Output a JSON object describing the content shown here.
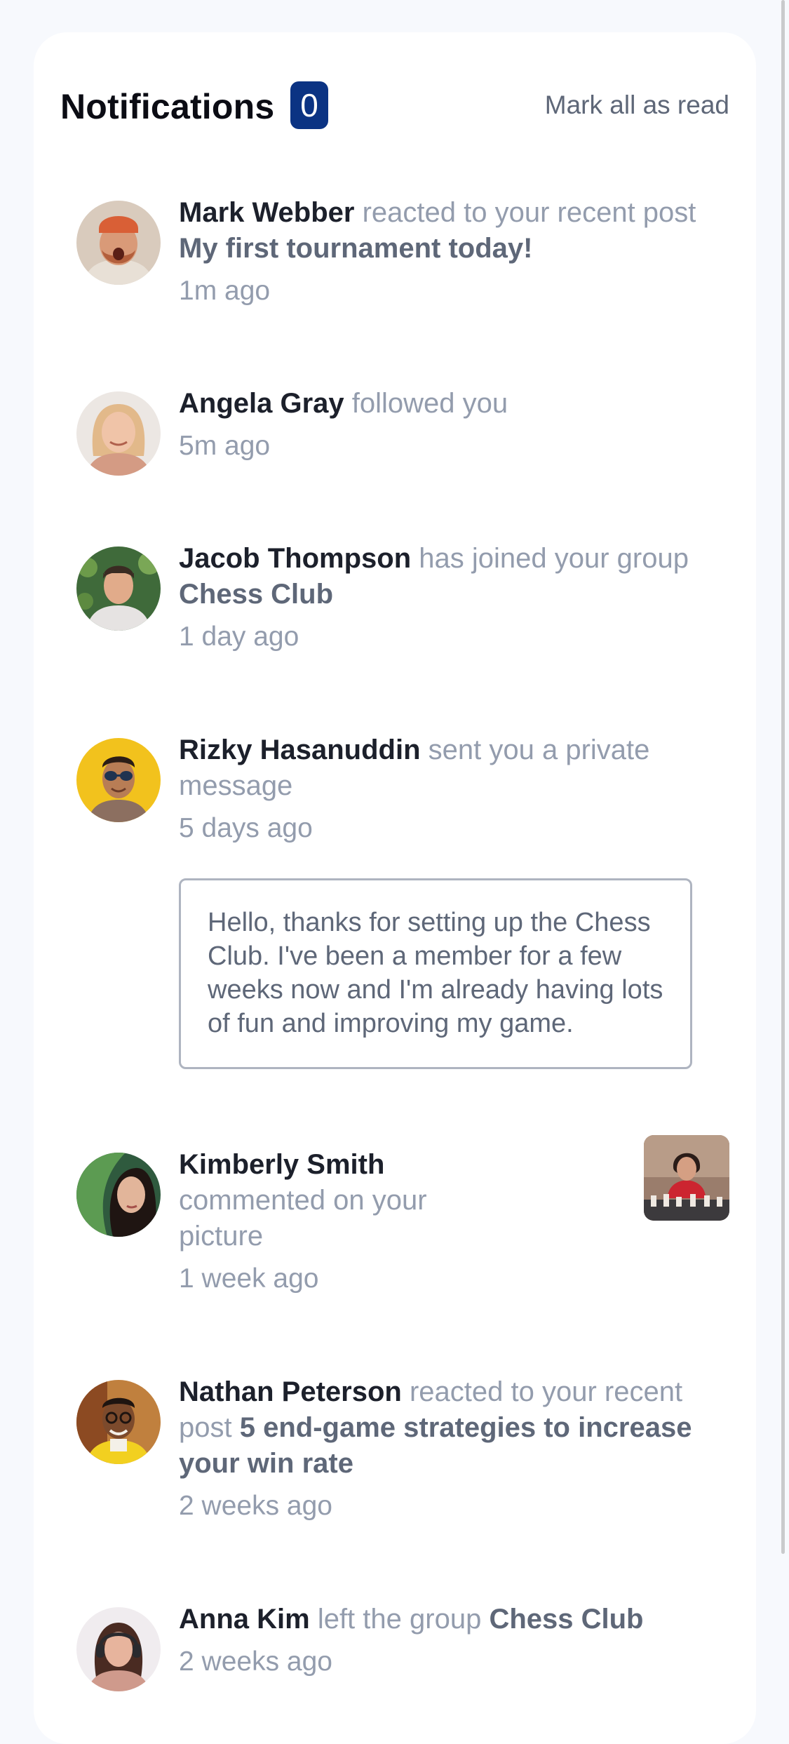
{
  "header": {
    "title": "Notifications",
    "unread_count": "0",
    "mark_all_label": "Mark all as read"
  },
  "notifications": [
    {
      "name": "Mark Webber",
      "action": "reacted to your recent post",
      "target": "My first tournament today!",
      "time": "1m ago",
      "avatar": "avatar-mark-webber"
    },
    {
      "name": "Angela Gray",
      "action": "followed you",
      "target": "",
      "time": "5m ago",
      "avatar": "avatar-angela-gray"
    },
    {
      "name": "Jacob Thompson",
      "action": "has joined your group",
      "target": "Chess Club",
      "time": "1 day ago",
      "avatar": "avatar-jacob-thompson"
    },
    {
      "name": "Rizky Hasanuddin",
      "action": "sent you a private message",
      "target": "",
      "time": "5 days ago",
      "avatar": "avatar-rizky-hasanuddin",
      "message": "Hello, thanks for setting up the Chess Club. I've been a member for a few weeks now and I'm already having lots of fun and improving my game."
    },
    {
      "name": "Kimberly Smith",
      "action": "commented on your picture",
      "target": "",
      "time": "1 week ago",
      "avatar": "avatar-kimberly-smith",
      "picture": "chess-picture-thumbnail"
    },
    {
      "name": "Nathan Peterson",
      "action": "reacted to your recent post",
      "target": "5 end-game strategies to increase your win rate",
      "time": "2 weeks ago",
      "avatar": "avatar-nathan-peterson"
    },
    {
      "name": "Anna Kim",
      "action": "left the group",
      "target": "Chess Club",
      "time": "2 weeks ago",
      "avatar": "avatar-anna-kim"
    }
  ],
  "colors": {
    "page_background": "#f7f9fd",
    "card_background": "#ffffff",
    "badge_background": "#0b3383",
    "name_text": "#1c202b",
    "target_text": "#5e6778",
    "muted_text": "#939cad"
  }
}
